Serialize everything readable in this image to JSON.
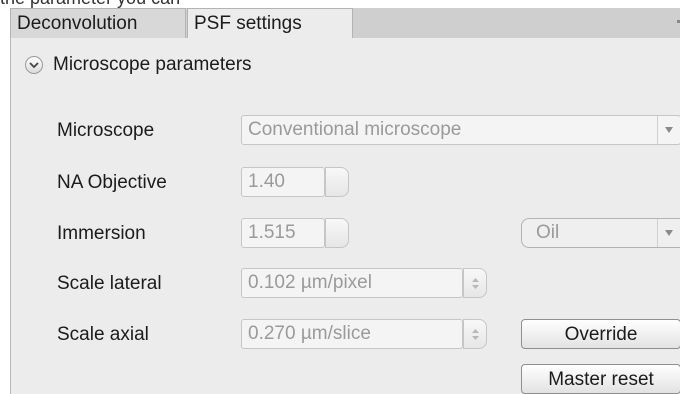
{
  "caption_fragment": "the parameter you can",
  "tabs": [
    {
      "label": "Deconvolution",
      "active": false
    },
    {
      "label": "PSF settings",
      "active": true
    }
  ],
  "section": {
    "title": "Microscope parameters",
    "expanded": true
  },
  "rows": {
    "microscope": {
      "label": "Microscope",
      "value": "Conventional microscope"
    },
    "na_objective": {
      "label": "NA Objective",
      "value": "1.40"
    },
    "immersion": {
      "label": "Immersion",
      "value": "1.515",
      "medium": "Oil"
    },
    "scale_lateral": {
      "label": "Scale lateral",
      "value": "0.102 µm/pixel"
    },
    "scale_axial": {
      "label": "Scale axial",
      "value": "0.270 µm/slice"
    }
  },
  "buttons": {
    "override": "Override",
    "master_reset": "Master reset"
  },
  "icons": {
    "section_toggle": "chevron-down-icon",
    "dropdown": "triangle-down-icon",
    "spinner": "spin-arrows-icon"
  }
}
